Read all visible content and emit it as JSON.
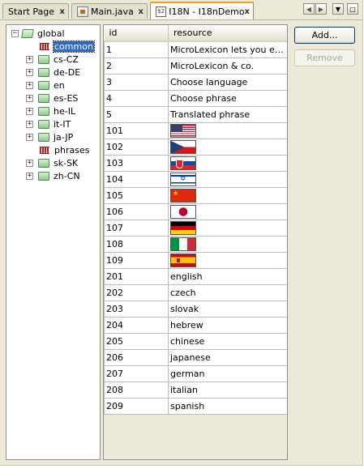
{
  "tabs": [
    {
      "label": "Start Page",
      "close": "x",
      "icon": "none"
    },
    {
      "label": "Main.java",
      "close": "x",
      "icon": "java-file-icon"
    },
    {
      "label": "I18N - I18nDemo",
      "close": "x",
      "icon": "i18n-icon",
      "icon_text": "$2",
      "active": true
    }
  ],
  "nav": {
    "left": "◀",
    "right": "▶",
    "dropdown": "▼",
    "maximize": "□"
  },
  "tree": {
    "collapse_symbol": "−",
    "expand_symbol": "+",
    "root": "global",
    "items": [
      {
        "label": "common",
        "type": "bundle",
        "selected": true
      },
      {
        "label": "cs-CZ",
        "type": "folder"
      },
      {
        "label": "de-DE",
        "type": "folder"
      },
      {
        "label": "en",
        "type": "folder"
      },
      {
        "label": "es-ES",
        "type": "folder"
      },
      {
        "label": "he-IL",
        "type": "folder"
      },
      {
        "label": "it-IT",
        "type": "folder"
      },
      {
        "label": "ja-JP",
        "type": "folder"
      },
      {
        "label": "phrases",
        "type": "bundle"
      },
      {
        "label": "sk-SK",
        "type": "folder"
      },
      {
        "label": "zh-CN",
        "type": "folder"
      }
    ]
  },
  "table": {
    "headers": [
      "id",
      "resource"
    ],
    "rows": [
      {
        "id": "1",
        "resource": "MicroLexicon lets you easil..."
      },
      {
        "id": "2",
        "resource": "MicroLexicon & co."
      },
      {
        "id": "3",
        "resource": "Choose language"
      },
      {
        "id": "4",
        "resource": "Choose phrase"
      },
      {
        "id": "5",
        "resource": "Translated phrase"
      },
      {
        "id": "101",
        "flag": "us"
      },
      {
        "id": "102",
        "flag": "cz"
      },
      {
        "id": "103",
        "flag": "sk"
      },
      {
        "id": "104",
        "flag": "il"
      },
      {
        "id": "105",
        "flag": "cn"
      },
      {
        "id": "106",
        "flag": "jp"
      },
      {
        "id": "107",
        "flag": "de"
      },
      {
        "id": "108",
        "flag": "it"
      },
      {
        "id": "109",
        "flag": "es"
      },
      {
        "id": "201",
        "resource": "english"
      },
      {
        "id": "202",
        "resource": "czech"
      },
      {
        "id": "203",
        "resource": "slovak"
      },
      {
        "id": "204",
        "resource": "hebrew"
      },
      {
        "id": "205",
        "resource": "chinese"
      },
      {
        "id": "206",
        "resource": "japanese"
      },
      {
        "id": "207",
        "resource": "german"
      },
      {
        "id": "208",
        "resource": "italian"
      },
      {
        "id": "209",
        "resource": "spanish"
      }
    ]
  },
  "buttons": {
    "add": "Add...",
    "remove": "Remove",
    "remove_enabled": false
  },
  "colors": {
    "selection": "#316ac5",
    "active_tab_accent": "#e8a02c",
    "panel_bg": "#ece9d8"
  }
}
